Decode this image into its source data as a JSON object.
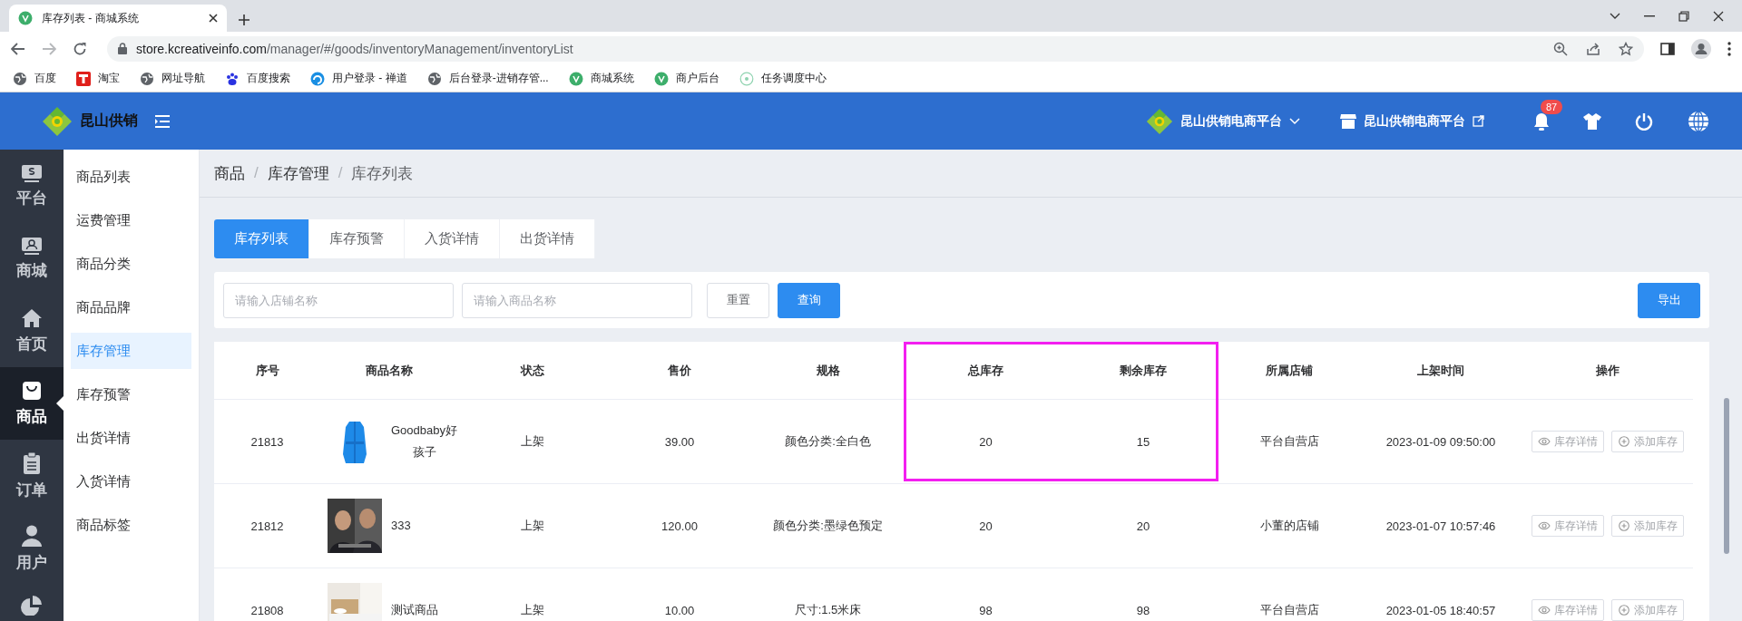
{
  "browser": {
    "tab_title": "库存列表 - 商城系统",
    "url_host": "store.kcreativeinfo.com",
    "url_path": "/manager/#/goods/inventoryManagement/inventoryList",
    "bookmarks": [
      {
        "label": "百度",
        "kind": "globe"
      },
      {
        "label": "淘宝",
        "kind": "taobao"
      },
      {
        "label": "网址导航",
        "kind": "globe"
      },
      {
        "label": "百度搜索",
        "kind": "paw"
      },
      {
        "label": "用户登录 - 禅道",
        "kind": "swirl"
      },
      {
        "label": "后台登录-进销存管...",
        "kind": "globe"
      },
      {
        "label": "商城系统",
        "kind": "leaf"
      },
      {
        "label": "商户后台",
        "kind": "leaf"
      },
      {
        "label": "任务调度中心",
        "kind": "ring"
      }
    ]
  },
  "header": {
    "logo_text": "昆山供销",
    "platform_menu": "昆山供销电商平台",
    "store_link": "昆山供销电商平台",
    "notification_count": "87"
  },
  "main_nav": [
    {
      "label": "平台",
      "kind": "card",
      "selected": false
    },
    {
      "label": "商城",
      "kind": "badge",
      "selected": false
    },
    {
      "label": "首页",
      "kind": "home",
      "selected": false
    },
    {
      "label": "商品",
      "kind": "bag",
      "selected": true
    },
    {
      "label": "订单",
      "kind": "clipboard",
      "selected": false
    },
    {
      "label": "用户",
      "kind": "user",
      "selected": false
    },
    {
      "kind": "pie",
      "selected": false
    }
  ],
  "sub_nav": [
    {
      "label": "商品列表",
      "selected": false
    },
    {
      "label": "运费管理",
      "selected": false
    },
    {
      "label": "商品分类",
      "selected": false
    },
    {
      "label": "商品品牌",
      "selected": false
    },
    {
      "label": "库存管理",
      "selected": true
    },
    {
      "label": "库存预警",
      "selected": false
    },
    {
      "label": "出货详情",
      "selected": false
    },
    {
      "label": "入货详情",
      "selected": false
    },
    {
      "label": "商品标签",
      "selected": false
    }
  ],
  "breadcrumb": [
    "商品",
    "库存管理",
    "库存列表"
  ],
  "breadcrumb_separator": "/",
  "tabs": [
    {
      "label": "库存列表",
      "selected": true
    },
    {
      "label": "库存预警",
      "selected": false
    },
    {
      "label": "入货详情",
      "selected": false
    },
    {
      "label": "出货详情",
      "selected": false
    }
  ],
  "filters": {
    "shop_placeholder": "请输入店铺名称",
    "product_placeholder": "请输入商品名称",
    "reset": "重置",
    "query": "查询",
    "export": "导出"
  },
  "table": {
    "columns": [
      "序号",
      "商品名称",
      "状态",
      "售价",
      "规格",
      "总库存",
      "剩余库存",
      "所属店铺",
      "上架时间",
      "操作"
    ],
    "rows": [
      {
        "id": "21813",
        "name": "Goodbaby好孩子",
        "image": {
          "kind": "picture"
        },
        "status": "上架",
        "price": "39.00",
        "spec": "颜色分类:全白色",
        "total_stock": "20",
        "remaining_stock": "15",
        "shop": "平台自营店",
        "listed_at": "2023-01-09 09:50:00",
        "actions": [
          {
            "label": "库存详情",
            "kind": "view"
          },
          {
            "label": "添加库存",
            "kind": "add"
          }
        ]
      },
      {
        "id": "21812",
        "name": "333",
        "image": {
          "kind": "picture"
        },
        "status": "上架",
        "price": "120.00",
        "spec": "颜色分类:墨绿色预定",
        "total_stock": "20",
        "remaining_stock": "20",
        "shop": "小董的店铺",
        "listed_at": "2023-01-07 10:57:46",
        "actions": [
          {
            "label": "库存详情",
            "kind": "view"
          },
          {
            "label": "添加库存",
            "kind": "add"
          }
        ]
      },
      {
        "id": "21808",
        "name": "测试商品",
        "image": {
          "kind": "picture"
        },
        "status": "上架",
        "price": "10.00",
        "spec": "尺寸:1.5米床",
        "total_stock": "98",
        "remaining_stock": "98",
        "shop": "平台自营店",
        "listed_at": "2023-01-05 18:40:57",
        "actions": [
          {
            "label": "库存详情",
            "kind": "view"
          },
          {
            "label": "添加库存",
            "kind": "add"
          }
        ]
      }
    ]
  }
}
